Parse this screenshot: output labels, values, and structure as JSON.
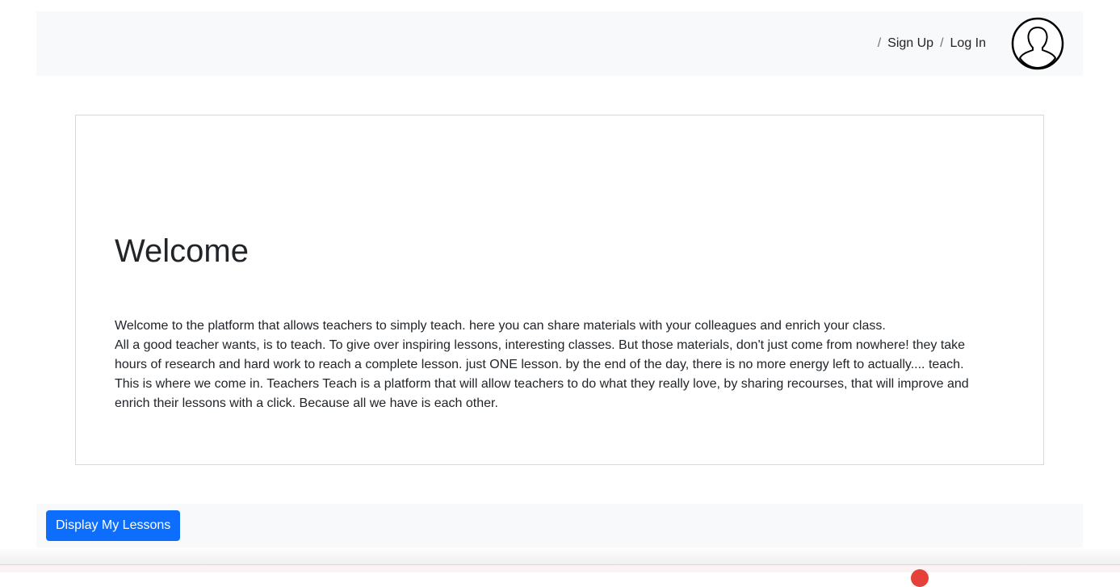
{
  "navbar": {
    "separator": "/",
    "signup_label": "Sign Up",
    "login_label": "Log In",
    "avatar_icon": "user-avatar-icon"
  },
  "main": {
    "title": "Welcome",
    "paragraphs": [
      "Welcome to the platform that allows teachers to simply teach. here you can share materials with your colleagues and enrich your class.",
      "All a good teacher wants, is to teach. To give over inspiring lessons, interesting classes. But those materials, don't just come from nowhere! they take hours of research and hard work to reach a complete lesson. just ONE lesson. by the end of the day, there is no more energy left to actually.... teach.",
      "This is where we come in. Teachers Teach is a platform that will allow teachers to do what they really love, by sharing recourses, that will improve and enrich their lessons with a click. Because all we have is each other."
    ]
  },
  "footer": {
    "display_lessons_label": "Display My Lessons"
  },
  "colors": {
    "primary": "#0d6efd",
    "navbar_bg": "#f8f9fa",
    "text": "#212529"
  }
}
